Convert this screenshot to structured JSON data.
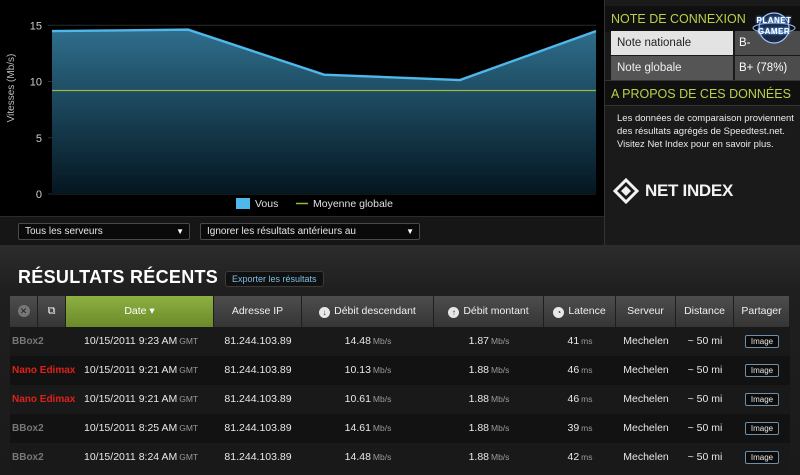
{
  "chart_data": {
    "type": "area",
    "ylabel": "Vitesses (Mb/s)",
    "yticks": [
      0,
      5,
      10,
      15
    ],
    "ylim": [
      0,
      16
    ],
    "x": [
      0,
      1,
      2,
      3,
      4
    ],
    "series": [
      {
        "name": "Vous",
        "values": [
          14.48,
          14.61,
          10.61,
          10.13,
          14.48
        ],
        "color": "#4fb8ea"
      },
      {
        "name": "Moyenne globale",
        "values": [
          9.2,
          9.2,
          9.2,
          9.2,
          9.2
        ],
        "color": "#9ab840"
      }
    ],
    "legend_position": "bottom"
  },
  "controls": {
    "servers_value": "Tous les serveurs",
    "ignore_value": "Ignorer les résultats antérieurs au"
  },
  "right_panel": {
    "conn_heading": "NOTE DE CONNEXION",
    "national_label": "Note nationale",
    "national_value": "B-",
    "global_label": "Note globale",
    "global_value": "B+ (78%)",
    "about_heading": "A PROPOS DE CES DONNÉES",
    "about_text": "Les données de comparaison proviennent des résultats agrégés de Speedtest.net. Visitez Net Index pour en savoir plus.",
    "netindex_label": "NET INDEX",
    "planet_line1": "PLANET",
    "planet_line2": "GAMER"
  },
  "results": {
    "title": "RÉSULTATS RÉCENTS",
    "export_label": "Exporter les résultats",
    "headers": {
      "date": "Date ▾",
      "ip": "Adresse IP",
      "down": "Débit descendant",
      "up": "Débit montant",
      "latency": "Latence",
      "server": "Serveur",
      "distance": "Distance",
      "share": "Partager"
    },
    "rows": [
      {
        "name": "BBox2",
        "name_color": "gray",
        "date": "10/15/2011 9:23 AM",
        "tz": "GMT",
        "ip": "81.244.103.89",
        "down": "14.48",
        "up": "1.87",
        "latency": "41",
        "server": "Mechelen",
        "distance": "~ 50 mi",
        "share": "Image"
      },
      {
        "name": "Nano Edimax",
        "name_color": "red",
        "date": "10/15/2011 9:21 AM",
        "tz": "GMT",
        "ip": "81.244.103.89",
        "down": "10.13",
        "up": "1.88",
        "latency": "46",
        "server": "Mechelen",
        "distance": "~ 50 mi",
        "share": "Image"
      },
      {
        "name": "Nano Edimax",
        "name_color": "red",
        "date": "10/15/2011 9:21 AM",
        "tz": "GMT",
        "ip": "81.244.103.89",
        "down": "10.61",
        "up": "1.88",
        "latency": "46",
        "server": "Mechelen",
        "distance": "~ 50 mi",
        "share": "Image"
      },
      {
        "name": "BBox2",
        "name_color": "gray",
        "date": "10/15/2011 8:25 AM",
        "tz": "GMT",
        "ip": "81.244.103.89",
        "down": "14.61",
        "up": "1.88",
        "latency": "39",
        "server": "Mechelen",
        "distance": "~ 50 mi",
        "share": "Image"
      },
      {
        "name": "BBox2",
        "name_color": "gray",
        "date": "10/15/2011 8:24 AM",
        "tz": "GMT",
        "ip": "81.244.103.89",
        "down": "14.48",
        "up": "1.88",
        "latency": "42",
        "server": "Mechelen",
        "distance": "~ 50 mi",
        "share": "Image"
      }
    ],
    "units": {
      "speed": "Mb/s",
      "latency": "ms"
    }
  }
}
